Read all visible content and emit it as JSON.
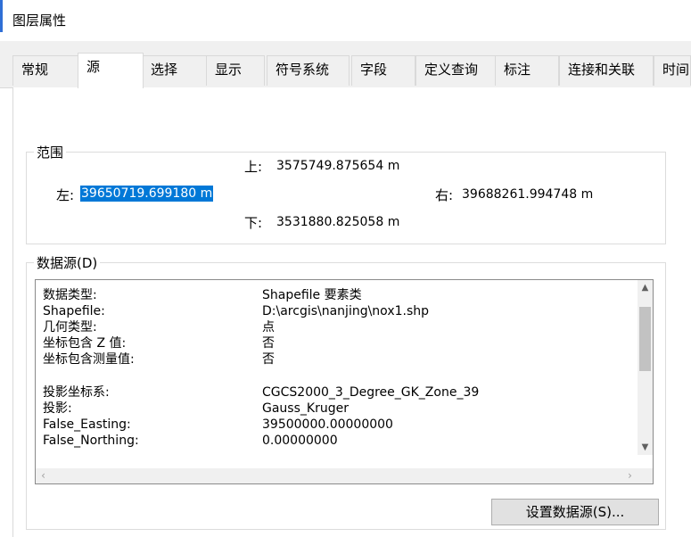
{
  "window": {
    "title": "图层属性"
  },
  "tabs": [
    {
      "label": "常规",
      "active": false
    },
    {
      "label": "源",
      "active": true
    },
    {
      "label": "选择",
      "active": false
    },
    {
      "label": "显示",
      "active": false
    },
    {
      "label": "符号系统",
      "active": false
    },
    {
      "label": "字段",
      "active": false
    },
    {
      "label": "定义查询",
      "active": false
    },
    {
      "label": "标注",
      "active": false
    },
    {
      "label": "连接和关联",
      "active": false
    },
    {
      "label": "时间",
      "active": false
    }
  ],
  "extent": {
    "legend": "范围",
    "top_label": "上:",
    "top_value": "3575749.875654 m",
    "left_label": "左:",
    "left_value": "39650719.699180 m",
    "right_label": "右:",
    "right_value": "39688261.994748 m",
    "bottom_label": "下:",
    "bottom_value": "3531880.825058 m"
  },
  "datasource": {
    "legend": "数据源(D)",
    "rows": [
      {
        "label": "数据类型:",
        "value": "Shapefile 要素类"
      },
      {
        "label": "Shapefile:",
        "value": "D:\\arcgis\\nanjing\\nox1.shp"
      },
      {
        "label": "几何类型:",
        "value": "点"
      },
      {
        "label": "坐标包含 Z 值:",
        "value": "否"
      },
      {
        "label": "坐标包含测量值:",
        "value": "否"
      },
      {
        "label": "投影坐标系:",
        "value": "CGCS2000_3_Degree_GK_Zone_39"
      },
      {
        "label": "投影:",
        "value": "Gauss_Kruger"
      },
      {
        "label": "False_Easting:",
        "value": "39500000.00000000"
      },
      {
        "label": "False_Northing:",
        "value": "0.00000000"
      }
    ],
    "set_button": "设置数据源(S)..."
  },
  "icons": {
    "scroll_up": "chevron-up-icon",
    "scroll_down": "chevron-down-icon",
    "scroll_left": "chevron-left-icon",
    "scroll_right": "chevron-right-icon"
  },
  "colors": {
    "selection": "#0078d7",
    "title_accent": "#2f6fd6"
  }
}
